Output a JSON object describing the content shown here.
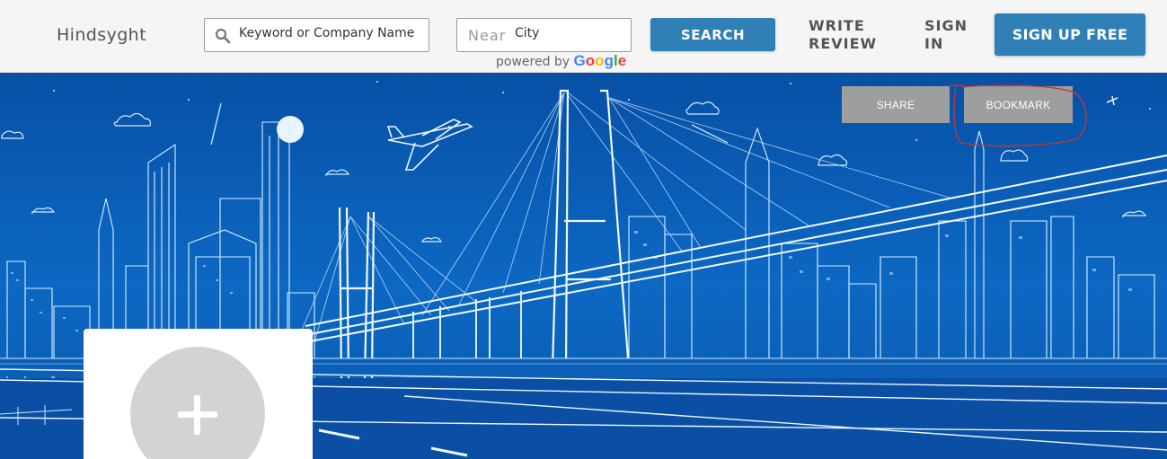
{
  "header": {
    "brand": "Hindsyght",
    "keyword_input": {
      "value": "Keyword or Company Name"
    },
    "near_input": {
      "label": "Near",
      "value": "City"
    },
    "powered_by": "powered by",
    "google": "Google",
    "search_button": "SEARCH",
    "write_review": [
      "WRITE",
      "REVIEW"
    ],
    "sign_in": [
      "SIGN",
      "IN"
    ],
    "signup_button": "SIGN UP FREE"
  },
  "hero": {
    "share_button": "SHARE",
    "bookmark_button": "BOOKMARK"
  },
  "colors": {
    "accent": "#2f80b6",
    "hero_bg": "#0b63b8",
    "annotation": "#c0392b"
  }
}
